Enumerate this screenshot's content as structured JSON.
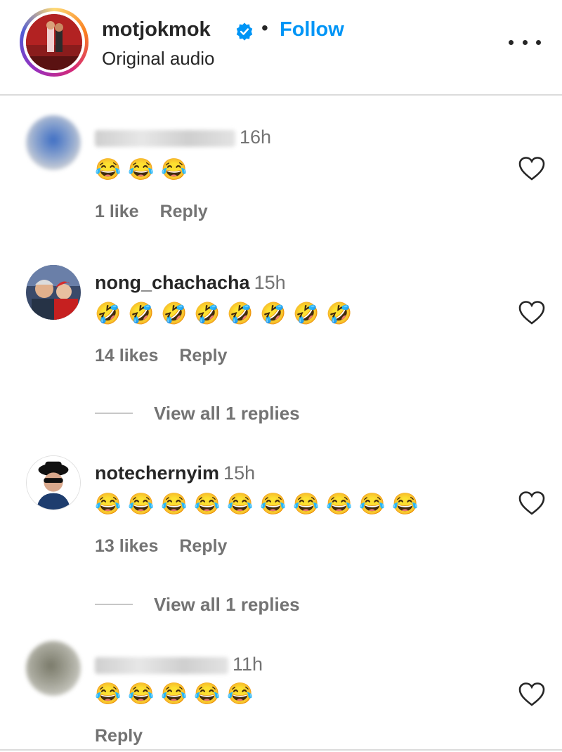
{
  "header": {
    "username": "motjokmok",
    "separator": "•",
    "follow_label": "Follow",
    "subtitle": "Original audio",
    "verified_icon": "verified-badge-icon",
    "more_icon": "more-options-icon"
  },
  "comments": [
    {
      "username_blurred": true,
      "time": "16h",
      "emojis": [
        "😂",
        "😂",
        "😂"
      ],
      "likes": "1 like",
      "reply_label": "Reply"
    },
    {
      "username": "nong_chachacha",
      "time": "15h",
      "emojis": [
        "🤣",
        "🤣",
        "🤣",
        "🤣",
        "🤣",
        "🤣",
        "🤣",
        "🤣"
      ],
      "likes": "14 likes",
      "reply_label": "Reply",
      "view_replies": "View all 1 replies"
    },
    {
      "username": "notechernyim",
      "time": "15h",
      "emojis": [
        "😂",
        "😂",
        "😂",
        "😂",
        "😂",
        "😂",
        "😂",
        "😂",
        "😂",
        "😂"
      ],
      "likes": "13 likes",
      "reply_label": "Reply",
      "view_replies": "View all 1 replies"
    },
    {
      "username_blurred": true,
      "time": "11h",
      "emojis": [
        "😂",
        "😂",
        "😂",
        "😂",
        "😂"
      ],
      "reply_label": "Reply"
    }
  ],
  "colors": {
    "link_blue": "#0095f6",
    "text": "#262626",
    "secondary": "#737373"
  }
}
